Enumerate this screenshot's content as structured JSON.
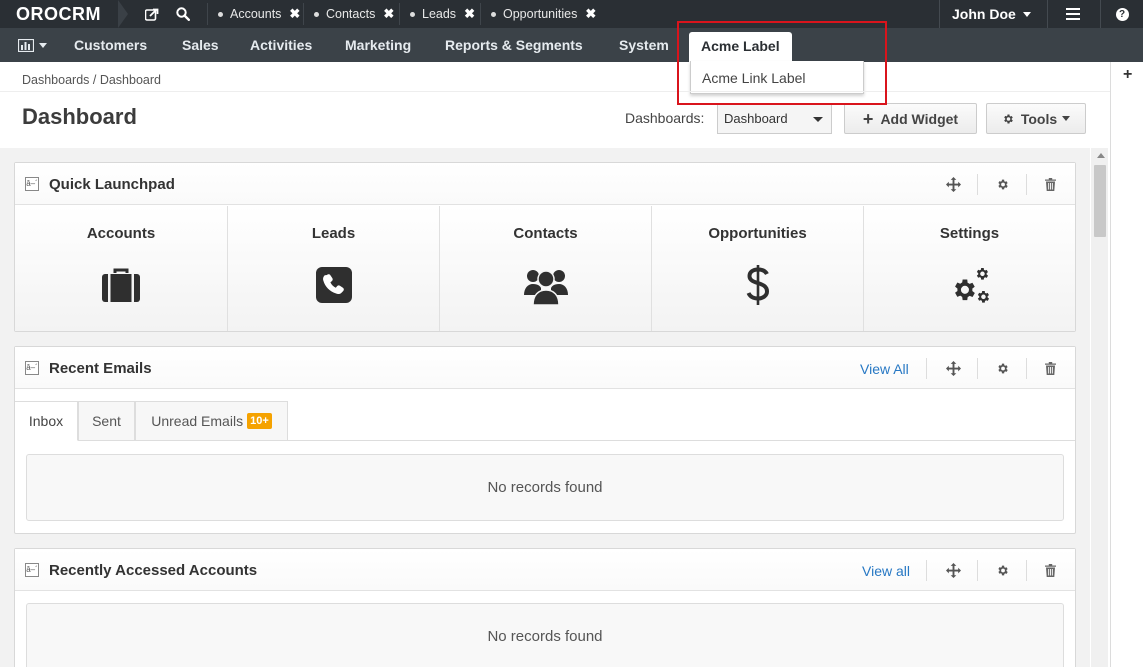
{
  "topbar": {
    "logo": "OROCRM",
    "pinned_tabs": [
      {
        "label": "Accounts"
      },
      {
        "label": "Contacts"
      },
      {
        "label": "Leads"
      },
      {
        "label": "Opportunities"
      }
    ],
    "close_glyph": "✖",
    "user_name": "John Doe",
    "help_glyph": "?"
  },
  "mainnav": {
    "items": [
      "Customers",
      "Sales",
      "Activities",
      "Marketing",
      "Reports & Segments",
      "System",
      "Acme Label"
    ],
    "active_item": "Acme Label",
    "dropdown_items": [
      "Acme Link Label"
    ]
  },
  "page": {
    "breadcrumb": "Dashboards / Dashboard",
    "title": "Dashboard",
    "dashboards_label": "Dashboards:",
    "dashboards_selected": "Dashboard",
    "add_widget_label": "Add Widget",
    "tools_label": "Tools"
  },
  "widgets": {
    "quick_launchpad": {
      "title": "Quick Launchpad",
      "items": [
        {
          "label": "Accounts",
          "icon": "briefcase-icon"
        },
        {
          "label": "Leads",
          "icon": "phone-icon"
        },
        {
          "label": "Contacts",
          "icon": "users-icon"
        },
        {
          "label": "Opportunities",
          "icon": "dollar-icon"
        },
        {
          "label": "Settings",
          "icon": "gears-icon"
        }
      ]
    },
    "recent_emails": {
      "title": "Recent Emails",
      "view_all": "View All",
      "tabs": [
        "Inbox",
        "Sent",
        "Unread Emails"
      ],
      "unread_badge": "10+",
      "empty": "No records found"
    },
    "recent_accounts": {
      "title": "Recently Accessed Accounts",
      "view_all": "View all",
      "empty": "No records found"
    }
  },
  "colors": {
    "topbar_bg": "#2a2f34",
    "nav_bg": "#3b4248",
    "link": "#2778c4",
    "badge": "#f5a200",
    "highlight": "#d9141c"
  }
}
